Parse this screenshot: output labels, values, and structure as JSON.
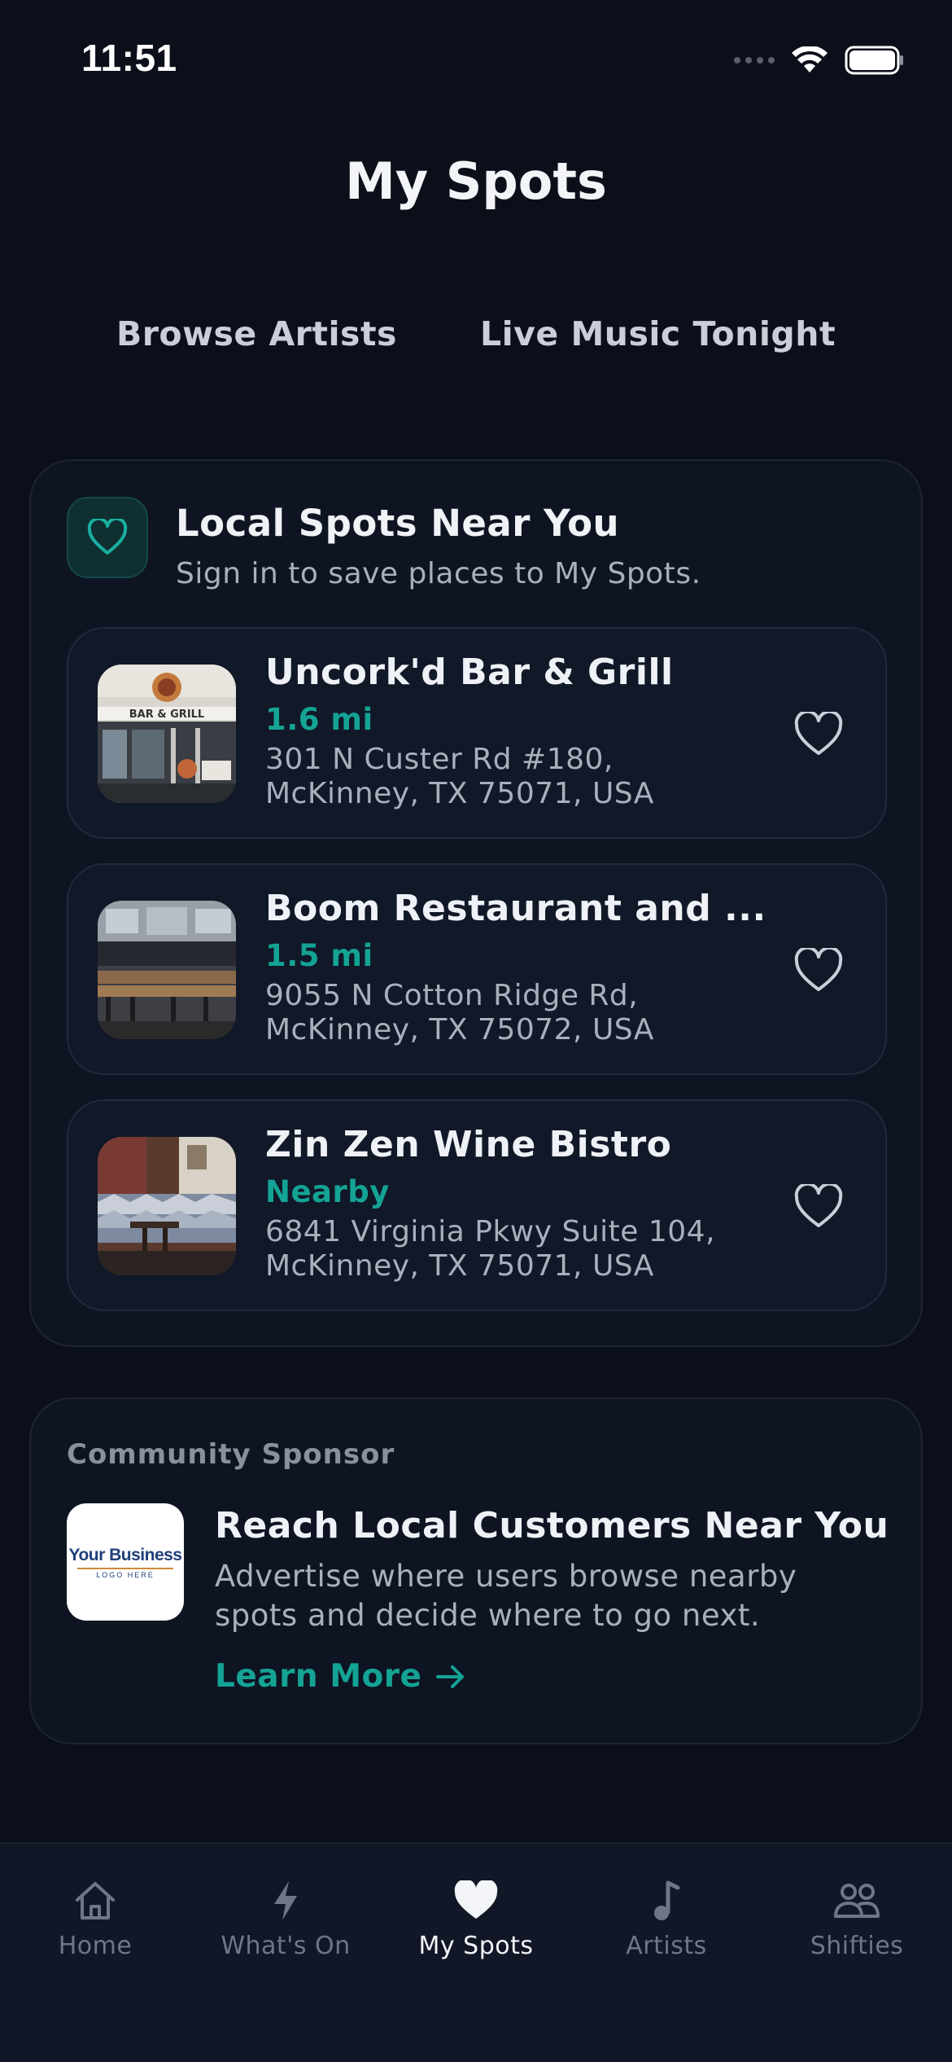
{
  "status_bar": {
    "time": "11:51"
  },
  "header": {
    "title": "My Spots"
  },
  "top_links": [
    {
      "label": "Browse Artists"
    },
    {
      "label": "Live Music Tonight"
    }
  ],
  "local_spots": {
    "title": "Local Spots Near You",
    "subtitle": "Sign in to save places to My Spots.",
    "items": [
      {
        "name": "Uncork'd Bar & Grill",
        "distance": "1.6 mi",
        "address_line1": "301 N Custer Rd #180,",
        "address_line2": "McKinney, TX 75071, USA",
        "favorited": false
      },
      {
        "name": "Boom Restaurant and ...",
        "distance": "1.5 mi",
        "address_line1": "9055 N Cotton Ridge Rd,",
        "address_line2": "McKinney, TX 75072, USA",
        "favorited": false
      },
      {
        "name": "Zin Zen Wine Bistro",
        "distance": "Nearby",
        "address_line1": "6841 Virginia Pkwy Suite 104,",
        "address_line2": "McKinney, TX 75071, USA",
        "favorited": false
      }
    ]
  },
  "sponsor": {
    "eyebrow": "Community Sponsor",
    "logo_text": "Your Business",
    "logo_subtext": "LOGO HERE",
    "title": "Reach Local Customers Near You",
    "description": "Advertise where users browse nearby spots and decide where to go next.",
    "cta_label": "Learn More"
  },
  "tab_bar": {
    "tabs": [
      {
        "label": "Home",
        "icon": "home-icon",
        "active": false
      },
      {
        "label": "What's On",
        "icon": "bolt-icon",
        "active": false
      },
      {
        "label": "My Spots",
        "icon": "heart-icon",
        "active": true
      },
      {
        "label": "Artists",
        "icon": "music-note-icon",
        "active": false
      },
      {
        "label": "Shifties",
        "icon": "people-icon",
        "active": false
      }
    ]
  },
  "colors": {
    "background": "#0b0f1a",
    "card": "#0e1422",
    "accent": "#14a394",
    "muted_text": "#a9afbb",
    "inactive_tab": "#6f7685"
  }
}
